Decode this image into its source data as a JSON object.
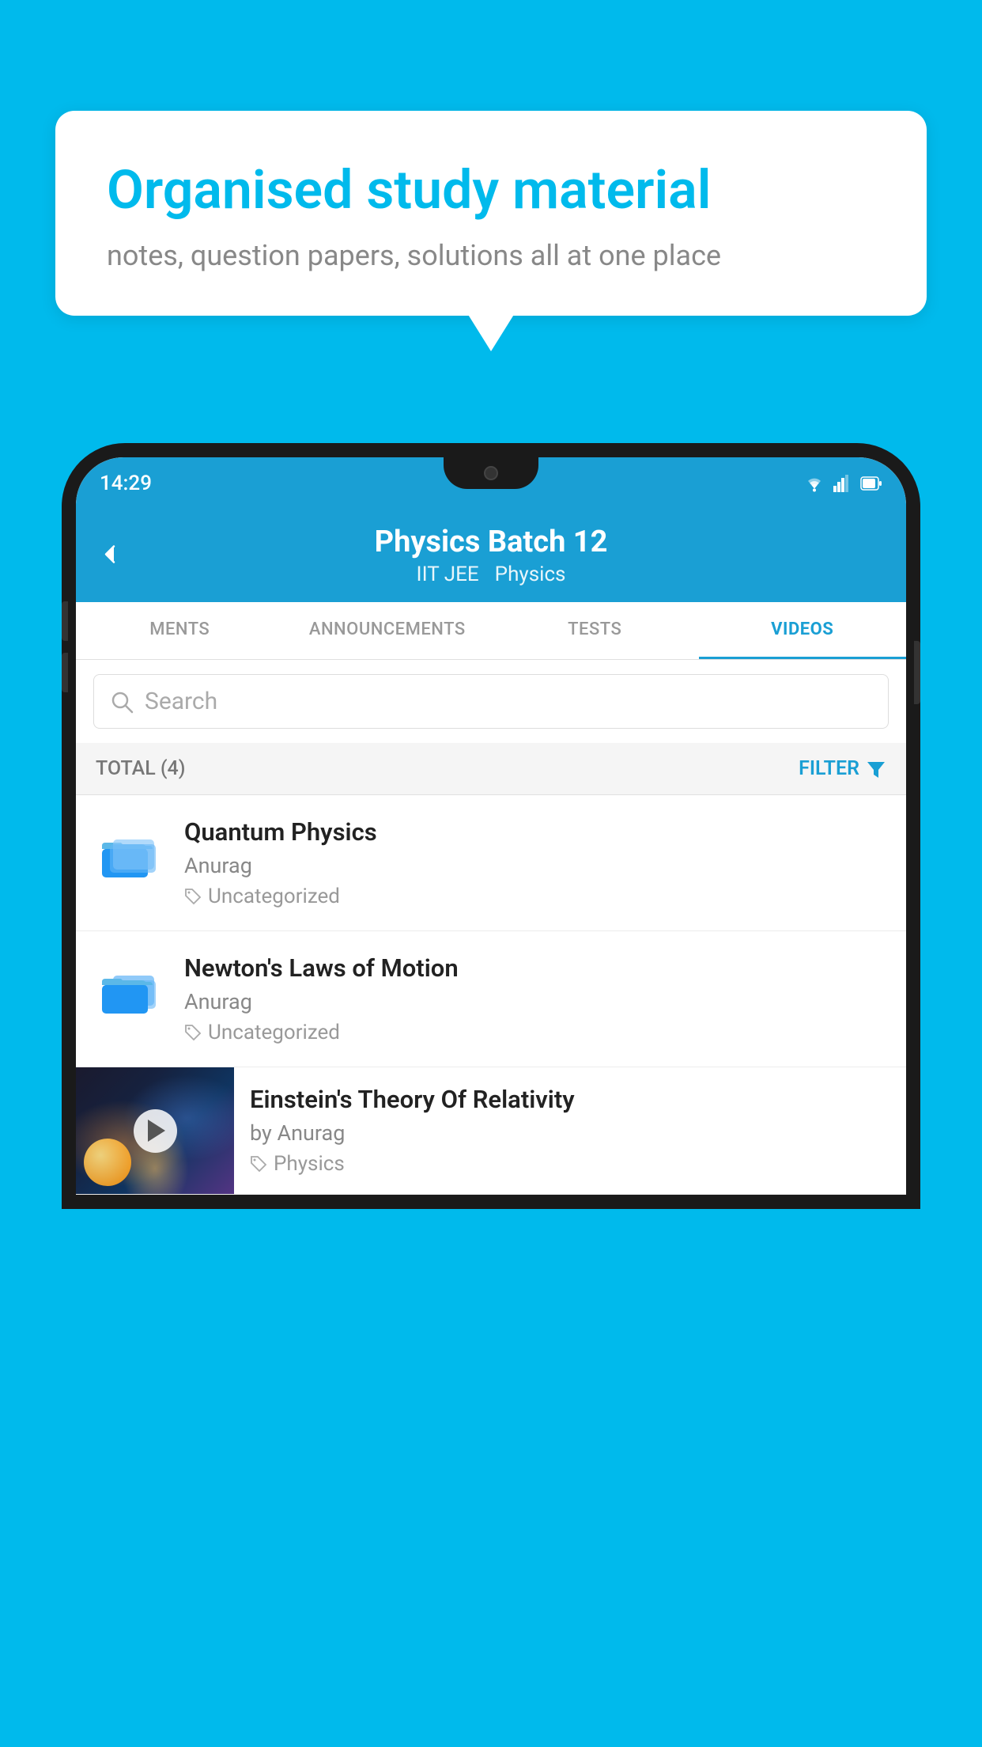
{
  "background_color": "#00BAEC",
  "speech_bubble": {
    "title": "Organised study material",
    "subtitle": "notes, question papers, solutions all at one place"
  },
  "status_bar": {
    "time": "14:29",
    "icons": [
      "wifi",
      "signal",
      "battery"
    ]
  },
  "app_header": {
    "title": "Physics Batch 12",
    "subtitle_left": "IIT JEE",
    "subtitle_right": "Physics",
    "back_label": "Back"
  },
  "tabs": [
    {
      "label": "MENTS",
      "active": false
    },
    {
      "label": "ANNOUNCEMENTS",
      "active": false
    },
    {
      "label": "TESTS",
      "active": false
    },
    {
      "label": "VIDEOS",
      "active": true
    }
  ],
  "search": {
    "placeholder": "Search"
  },
  "filter_bar": {
    "total_label": "TOTAL (4)",
    "filter_label": "FILTER"
  },
  "video_items": [
    {
      "title": "Quantum Physics",
      "author": "Anurag",
      "tag": "Uncategorized",
      "has_thumbnail": false
    },
    {
      "title": "Newton's Laws of Motion",
      "author": "Anurag",
      "tag": "Uncategorized",
      "has_thumbnail": false
    },
    {
      "title": "Einstein's Theory Of Relativity",
      "author": "by Anurag",
      "tag": "Physics",
      "has_thumbnail": true
    }
  ]
}
